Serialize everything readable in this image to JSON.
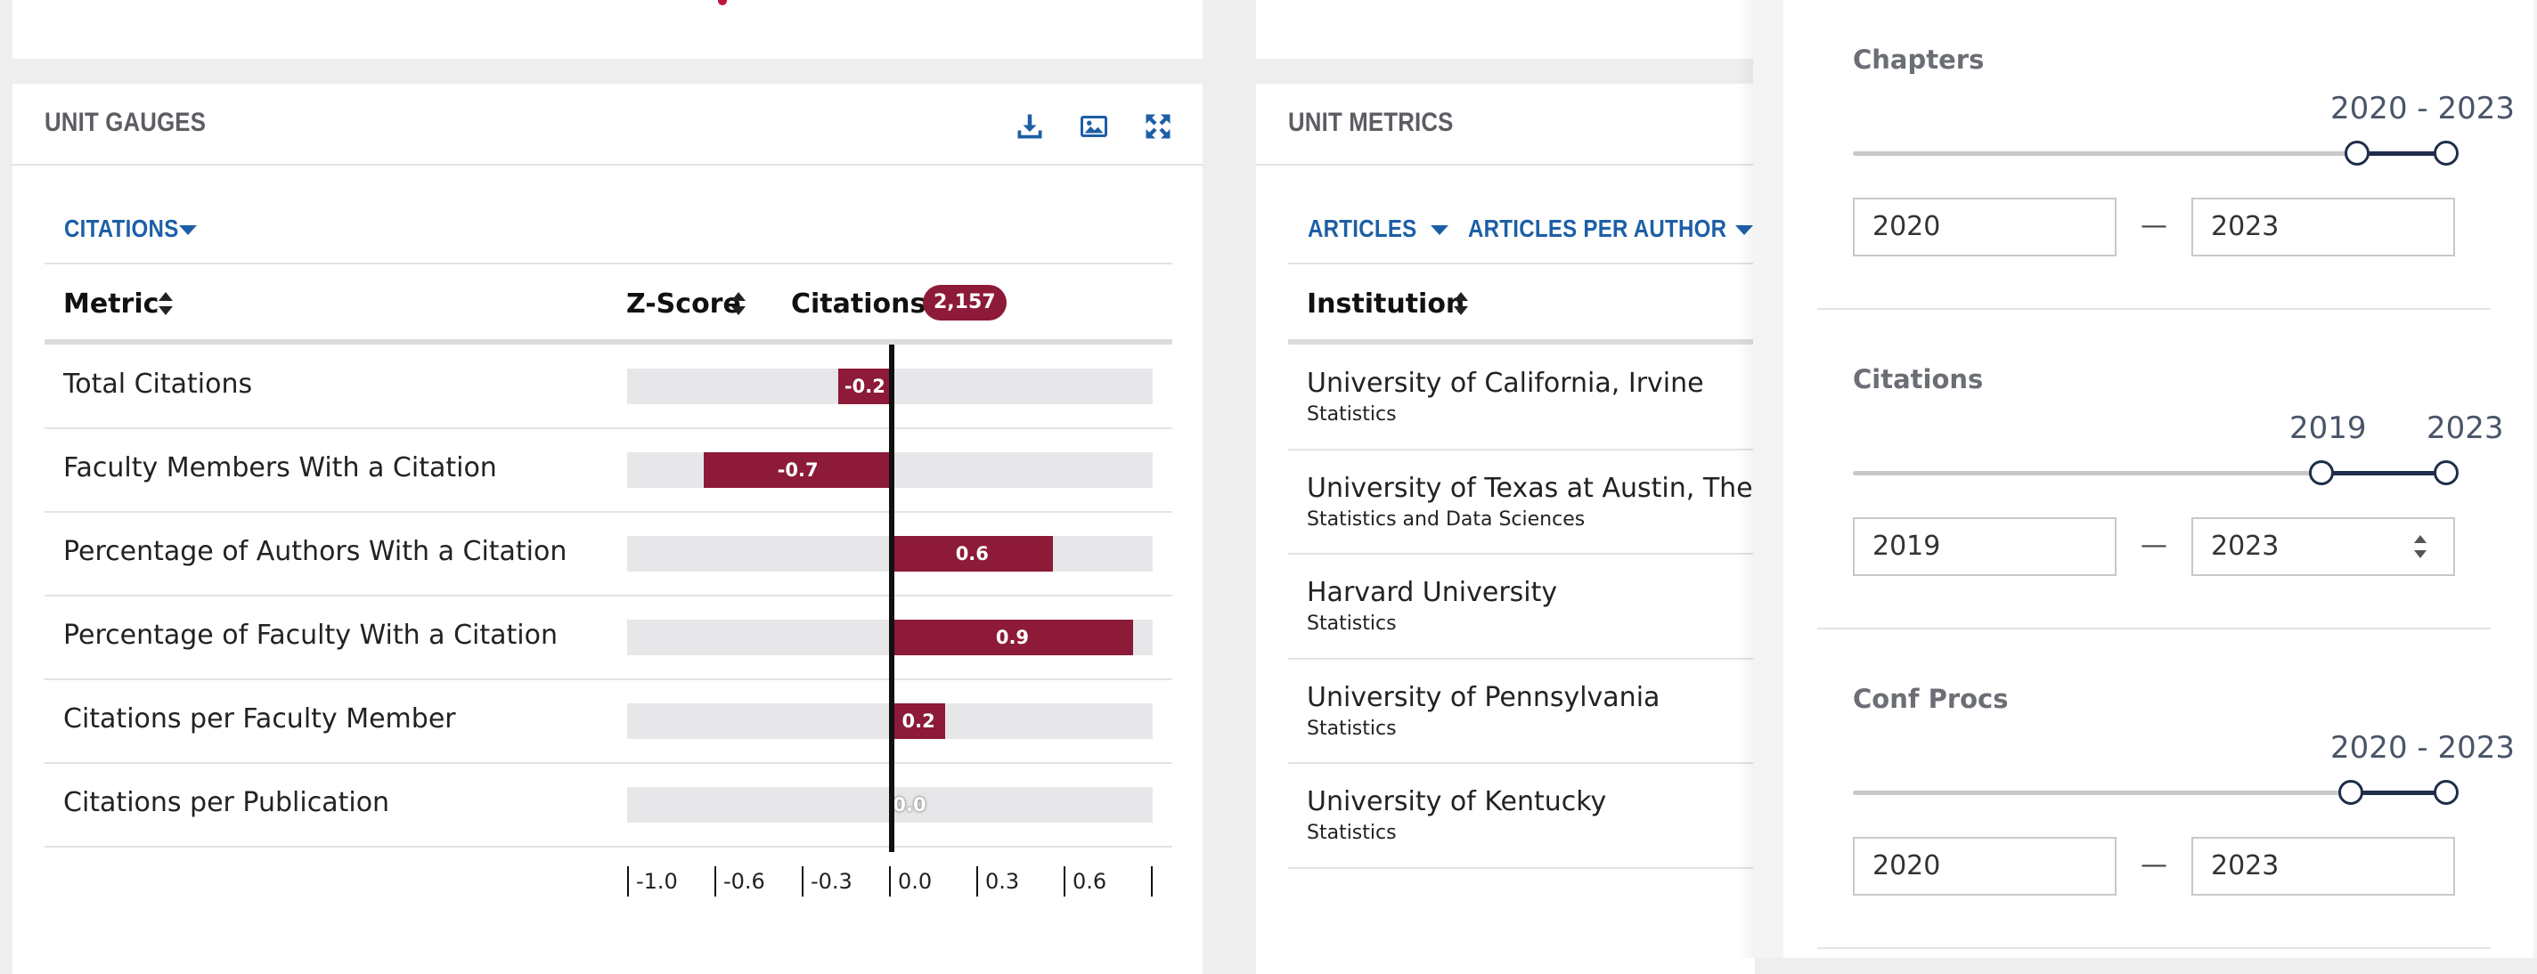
{
  "unit_gauges": {
    "title": "UNIT GAUGES",
    "dropdown": "CITATIONS",
    "header": {
      "metric": "Metric",
      "zscore": "Z-Score",
      "citations_label": "Citations:",
      "citations_count": "2,157"
    },
    "rows": [
      {
        "metric": "Total Citations",
        "value": -0.2,
        "label": "-0.2"
      },
      {
        "metric": "Faculty Members With a Citation",
        "value": -0.7,
        "label": "-0.7"
      },
      {
        "metric": "Percentage of Authors With a Citation",
        "value": 0.6,
        "label": "0.6"
      },
      {
        "metric": "Percentage of Faculty With a Citation",
        "value": 0.9,
        "label": "0.9"
      },
      {
        "metric": "Citations per Faculty Member",
        "value": 0.2,
        "label": "0.2"
      },
      {
        "metric": "Citations per Publication",
        "value": 0.0,
        "label": "0.0"
      }
    ],
    "axis_ticks": [
      "-1.0",
      "-0.6",
      "-0.3",
      "0.0",
      "0.3",
      "0.6"
    ],
    "colors": {
      "bar": "#8c1a38",
      "track": "#e7e7ea",
      "accent": "#1d5fa6"
    }
  },
  "unit_metrics": {
    "title": "UNIT METRICS",
    "dropdowns": [
      "ARTICLES",
      "ARTICLES PER AUTHOR"
    ],
    "header": {
      "institution": "Institution"
    },
    "rows": [
      {
        "name": "University of California, Irvine",
        "dept": "Statistics"
      },
      {
        "name": "University of Texas at Austin, The",
        "dept": "Statistics and Data Sciences"
      },
      {
        "name": "Harvard University",
        "dept": "Statistics"
      },
      {
        "name": "University of Pennsylvania",
        "dept": "Statistics"
      },
      {
        "name": "University of Kentucky",
        "dept": "Statistics"
      }
    ]
  },
  "filters": [
    {
      "title": "Chapters",
      "range_text": "2020 - 2023",
      "from": "2020",
      "to": "2023",
      "range_from": 0.85,
      "range_to": 1.0
    },
    {
      "title": "Citations",
      "range_from_text": "2019",
      "range_to_text": "2023",
      "from": "2019",
      "to": "2023",
      "range_from": 0.79,
      "range_to": 1.0
    },
    {
      "title": "Conf Procs",
      "range_text": "2020 - 2023",
      "from": "2020",
      "to": "2023",
      "range_from": 0.84,
      "range_to": 1.0
    }
  ],
  "icons": [
    "download-icon",
    "image-icon",
    "expand-icon",
    "sort-icon",
    "caret-down-icon",
    "spinner-icon"
  ]
}
